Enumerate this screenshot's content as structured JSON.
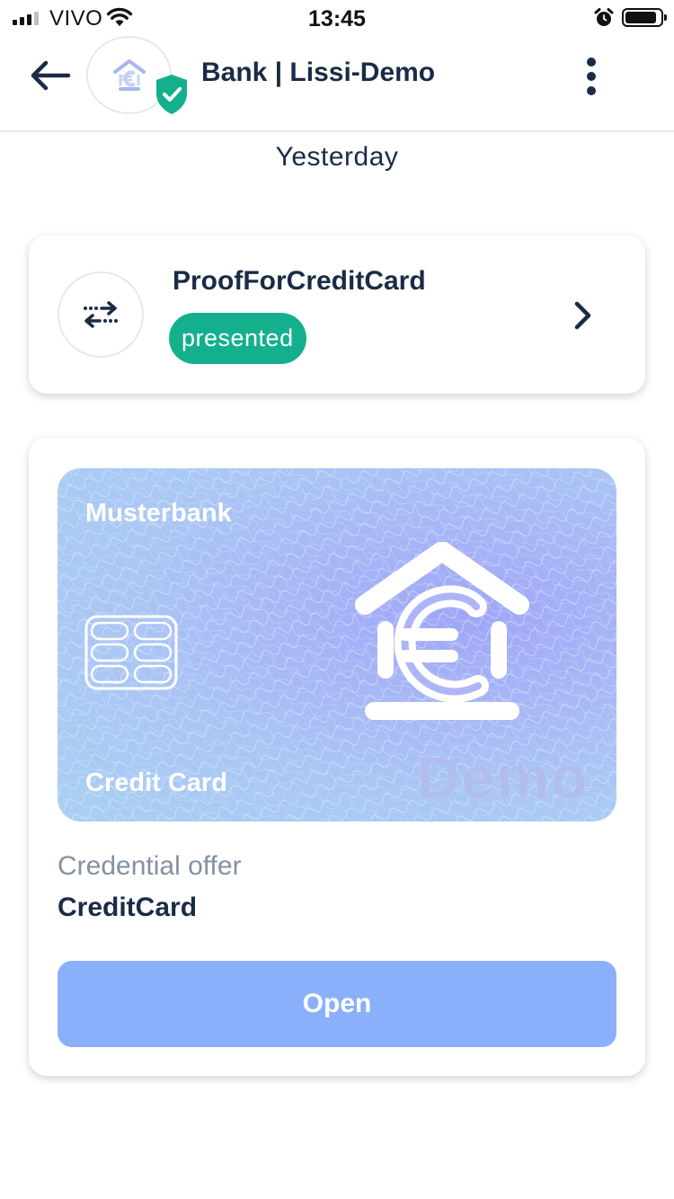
{
  "status_bar": {
    "carrier": "VIVO",
    "time": "13:45"
  },
  "header": {
    "title": "Bank | Lissi-Demo",
    "back_icon": "arrow-left-icon",
    "more_icon": "more-vertical-icon",
    "verified_icon": "shield-check-icon"
  },
  "timeline": {
    "date_label": "Yesterday"
  },
  "proof": {
    "title": "ProofForCreditCard",
    "status": "presented",
    "icon": "exchange-arrows-icon",
    "status_color": "#14b08d"
  },
  "offer": {
    "card": {
      "bank": "Musterbank",
      "type": "Credit Card",
      "watermark": "Demo"
    },
    "label": "Credential offer",
    "name": "CreditCard",
    "open_label": "Open",
    "button_color": "#8ab0fb"
  }
}
